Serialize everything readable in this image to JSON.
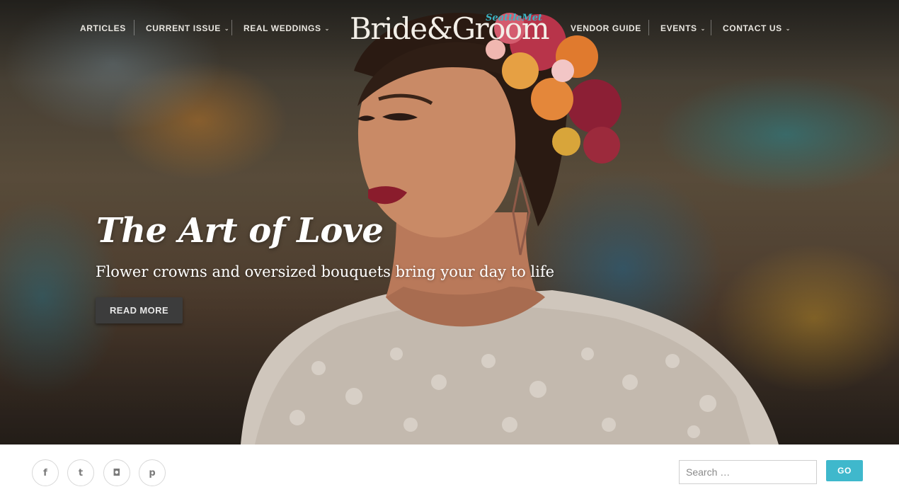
{
  "nav": {
    "left": [
      {
        "label": "ARTICLES",
        "dropdown": false
      },
      {
        "label": "CURRENT ISSUE",
        "dropdown": true
      },
      {
        "label": "REAL WEDDINGS",
        "dropdown": true
      }
    ],
    "right": [
      {
        "label": "VENDOR GUIDE",
        "dropdown": false
      },
      {
        "label": "EVENTS",
        "dropdown": true
      },
      {
        "label": "CONTACT US",
        "dropdown": true
      }
    ],
    "caret": "⌄"
  },
  "logo": {
    "main": "Bride&Groom",
    "sub": "SeattleMet"
  },
  "hero": {
    "title": "The Art of Love",
    "subtitle": "Flower crowns and oversized bouquets bring your day to life",
    "button": "READ MORE"
  },
  "footer": {
    "social": [
      {
        "name": "facebook-icon",
        "glyph": "f"
      },
      {
        "name": "twitter-icon",
        "glyph": "t"
      },
      {
        "name": "instagram-icon",
        "glyph": "◘"
      },
      {
        "name": "pinterest-icon",
        "glyph": "p"
      }
    ],
    "search": {
      "placeholder": "Search …",
      "button": "GO"
    }
  },
  "colors": {
    "accent": "#3fb8cc",
    "button_dark": "#3c3c3c",
    "logo_sub": "#3bb3c4"
  }
}
